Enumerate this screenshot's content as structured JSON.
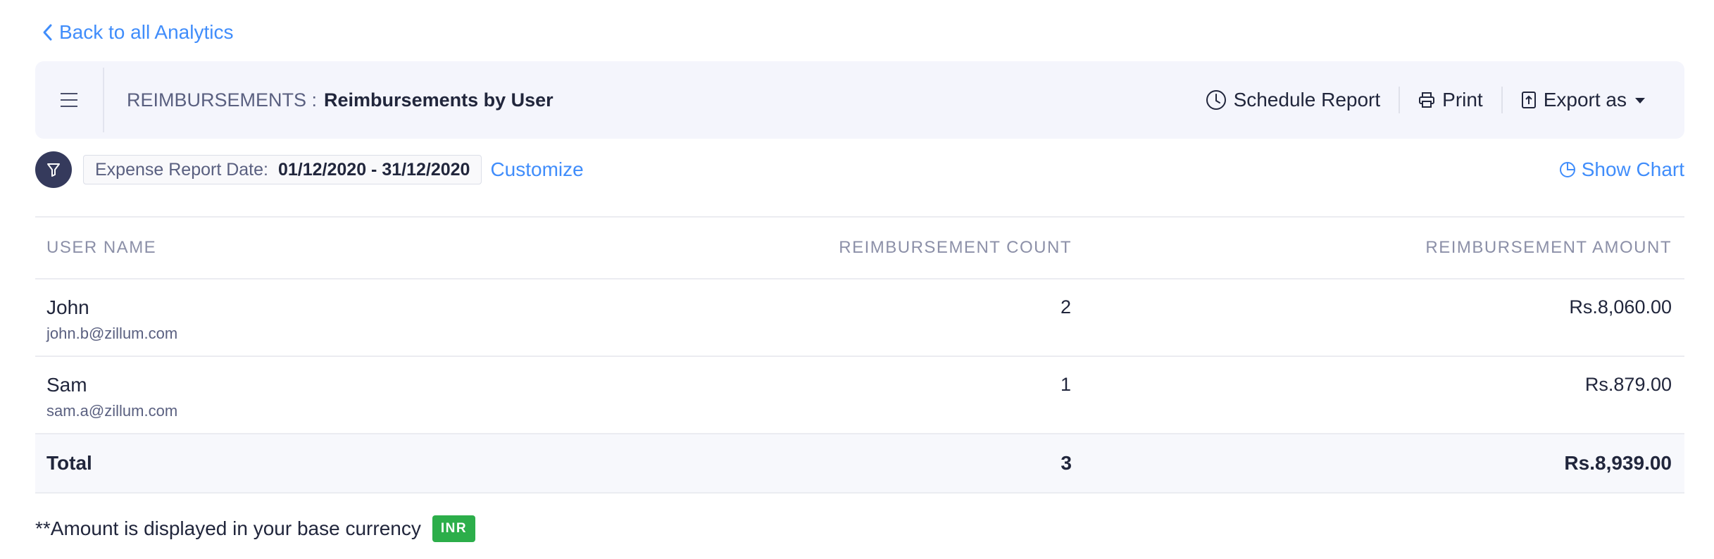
{
  "nav": {
    "back_label": "Back to all Analytics"
  },
  "header": {
    "module": "REIMBURSEMENTS :",
    "report_name": "Reimbursements by User",
    "actions": {
      "schedule": "Schedule Report",
      "print": "Print",
      "export": "Export as"
    }
  },
  "filters": {
    "label": "Expense Report Date:",
    "value": "01/12/2020 - 31/12/2020",
    "customize": "Customize",
    "show_chart": "Show Chart"
  },
  "table": {
    "columns": [
      "USER NAME",
      "REIMBURSEMENT COUNT",
      "REIMBURSEMENT AMOUNT"
    ],
    "rows": [
      {
        "name": "John",
        "email": "john.b@zillum.com",
        "count": "2",
        "amount": "Rs.8,060.00"
      },
      {
        "name": "Sam",
        "email": "sam.a@zillum.com",
        "count": "1",
        "amount": "Rs.879.00"
      }
    ],
    "total": {
      "label": "Total",
      "count": "3",
      "amount": "Rs.8,939.00"
    }
  },
  "footnote": {
    "text": "**Amount is displayed in your base currency",
    "currency": "INR"
  },
  "colors": {
    "accent": "#408dfb",
    "badge": "#2cae4a",
    "filter_button": "#353a5c"
  }
}
